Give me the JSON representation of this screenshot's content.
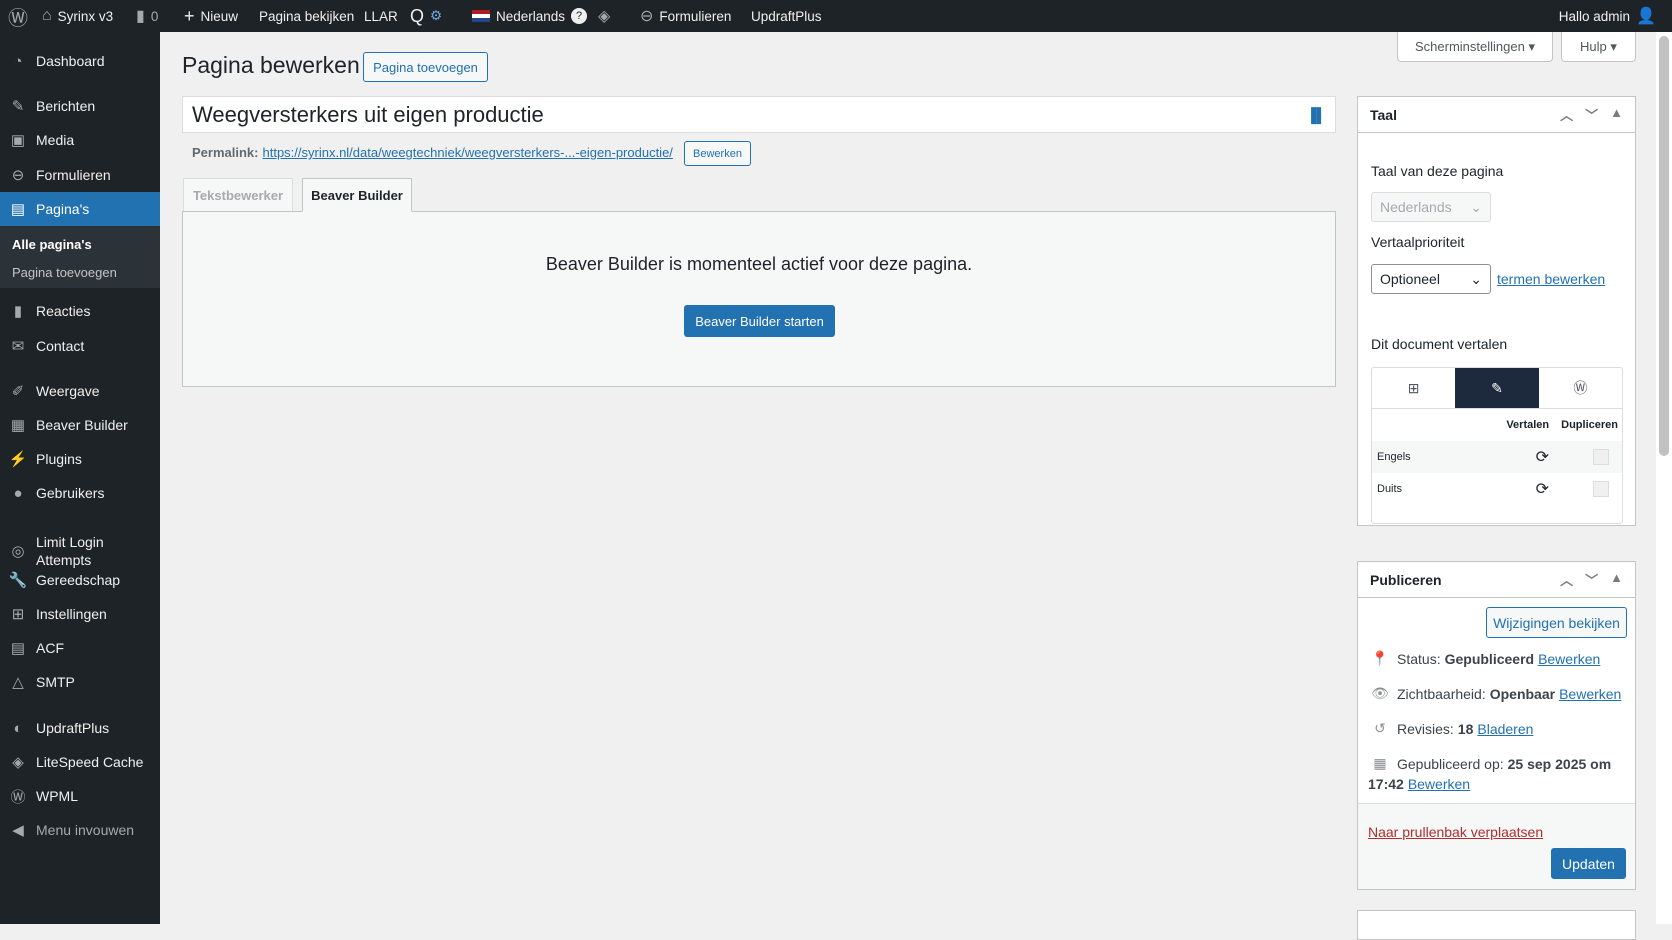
{
  "adminbar": {
    "site": "Syrinx v3",
    "comments": "0",
    "new": "Nieuw",
    "view_page": "Pagina bekijken",
    "llar": "LLAR",
    "language": "Nederlands",
    "forms": "Formulieren",
    "updraft": "UpdraftPlus",
    "greeting": "Hallo admin"
  },
  "sidebar": {
    "items": [
      {
        "label": "Dashboard",
        "icon": "dashboard-icon"
      },
      {
        "label": "Berichten",
        "icon": "pin-icon"
      },
      {
        "label": "Media",
        "icon": "media-icon"
      },
      {
        "label": "Formulieren",
        "icon": "forms-icon"
      },
      {
        "label": "Pagina's",
        "icon": "pages-icon"
      },
      {
        "label": "Reacties",
        "icon": "comments-icon"
      },
      {
        "label": "Contact",
        "icon": "mail-icon"
      },
      {
        "label": "Weergave",
        "icon": "brush-icon"
      },
      {
        "label": "Beaver Builder",
        "icon": "grid-icon"
      },
      {
        "label": "Plugins",
        "icon": "plugin-icon"
      },
      {
        "label": "Gebruikers",
        "icon": "user-icon"
      },
      {
        "label": "Limit Login Attempts",
        "icon": "fingerprint-icon"
      },
      {
        "label": "Gereedschap",
        "icon": "wrench-icon"
      },
      {
        "label": "Instellingen",
        "icon": "settings-icon"
      },
      {
        "label": "ACF",
        "icon": "table-icon"
      },
      {
        "label": "SMTP",
        "icon": "smtp-icon"
      },
      {
        "label": "UpdraftPlus",
        "icon": "updraft-icon"
      },
      {
        "label": "LiteSpeed Cache",
        "icon": "litespeed-icon"
      },
      {
        "label": "WPML",
        "icon": "wpml-icon"
      },
      {
        "label": "Menu invouwen",
        "icon": "collapse-icon"
      }
    ],
    "sub": [
      "Alle pagina's",
      "Pagina toevoegen"
    ]
  },
  "header": {
    "title": "Pagina bewerken",
    "add": "Pagina toevoegen",
    "screen_options": "Scherminstellingen",
    "help": "Hulp"
  },
  "editor": {
    "post_title": "Weegversterkers uit eigen productie",
    "permalink_label": "Permalink:",
    "permalink": "https://syrinx.nl/data/weegtechniek/weegversterkers-...-eigen-productie/",
    "permalink_edit": "Bewerken",
    "tabs": [
      "Tekstbewerker",
      "Beaver Builder"
    ],
    "bb_message": "Beaver Builder is momenteel actief voor deze pagina.",
    "bb_button": "Beaver Builder starten"
  },
  "language_box": {
    "title": "Taal",
    "page_lang_label": "Taal van deze pagina",
    "page_lang": "Nederlands",
    "priority_label": "Vertaalprioriteit",
    "priority": "Optioneel",
    "terms_link": "termen bewerken",
    "translate_label": "Dit document vertalen",
    "col_translate": "Vertalen",
    "col_duplicate": "Dupliceren",
    "languages": [
      "Engels",
      "Duits"
    ]
  },
  "publish_box": {
    "title": "Publiceren",
    "preview": "Wijzigingen bekijken",
    "status_label": "Status:",
    "status": "Gepubliceerd",
    "visibility_label": "Zichtbaarheid:",
    "visibility": "Openbaar",
    "revisions_label": "Revisies:",
    "revisions": "18",
    "revisions_link": "Bladeren",
    "published_label": "Gepubliceerd op:",
    "published_date": "25 sep 2025 om",
    "published_time": "17:42",
    "edit": "Bewerken",
    "trash": "Naar prullenbak verplaatsen",
    "update": "Updaten"
  }
}
